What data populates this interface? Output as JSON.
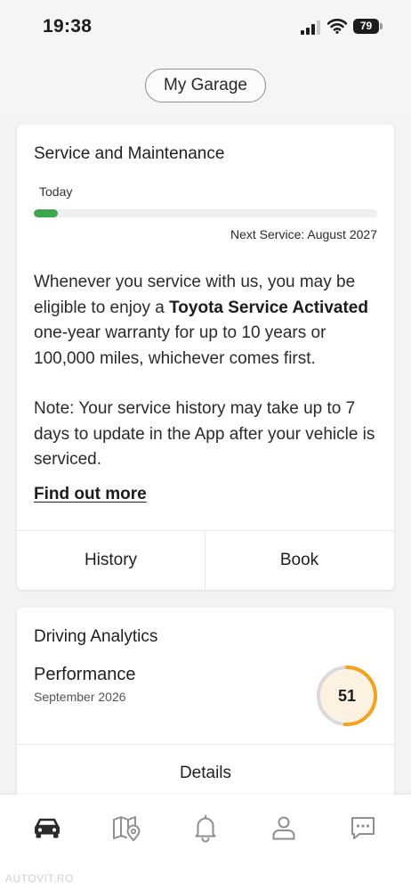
{
  "status_bar": {
    "time": "19:38",
    "battery": "79"
  },
  "header": {
    "garage_button": "My Garage"
  },
  "service": {
    "title": "Service and Maintenance",
    "progress_label": "Today",
    "progress_fraction": 0.07,
    "next_service": "Next Service: August 2027",
    "desc_before": "Whenever you service with us, you may be eligible to enjoy a ",
    "desc_bold": "Toyota Service Activated",
    "desc_after": " one-year warranty for up to 10 years or 100,000 miles, whichever comes first.",
    "note": "Note: Your service history may take up to 7 days to update in the App after your vehicle is serviced.",
    "find_more": "Find out more",
    "history_button": "History",
    "book_button": "Book"
  },
  "analytics": {
    "title": "Driving Analytics",
    "performance_label": "Performance",
    "performance_date": "September 2026",
    "score": "51",
    "score_fraction": 0.51,
    "details_button": "Details"
  },
  "tabs": [
    "car-icon",
    "map-icon",
    "bell-icon",
    "profile-icon",
    "chat-icon"
  ],
  "watermark": "AUTOVIT.RO",
  "colors": {
    "progress": "#3aa84a",
    "gauge": "#f5a11a",
    "gauge_bg": "#fdf1e2",
    "gauge_track": "#d9d9de",
    "active_tab": "#2a2a2c",
    "inactive_tab": "#8e8e93"
  }
}
